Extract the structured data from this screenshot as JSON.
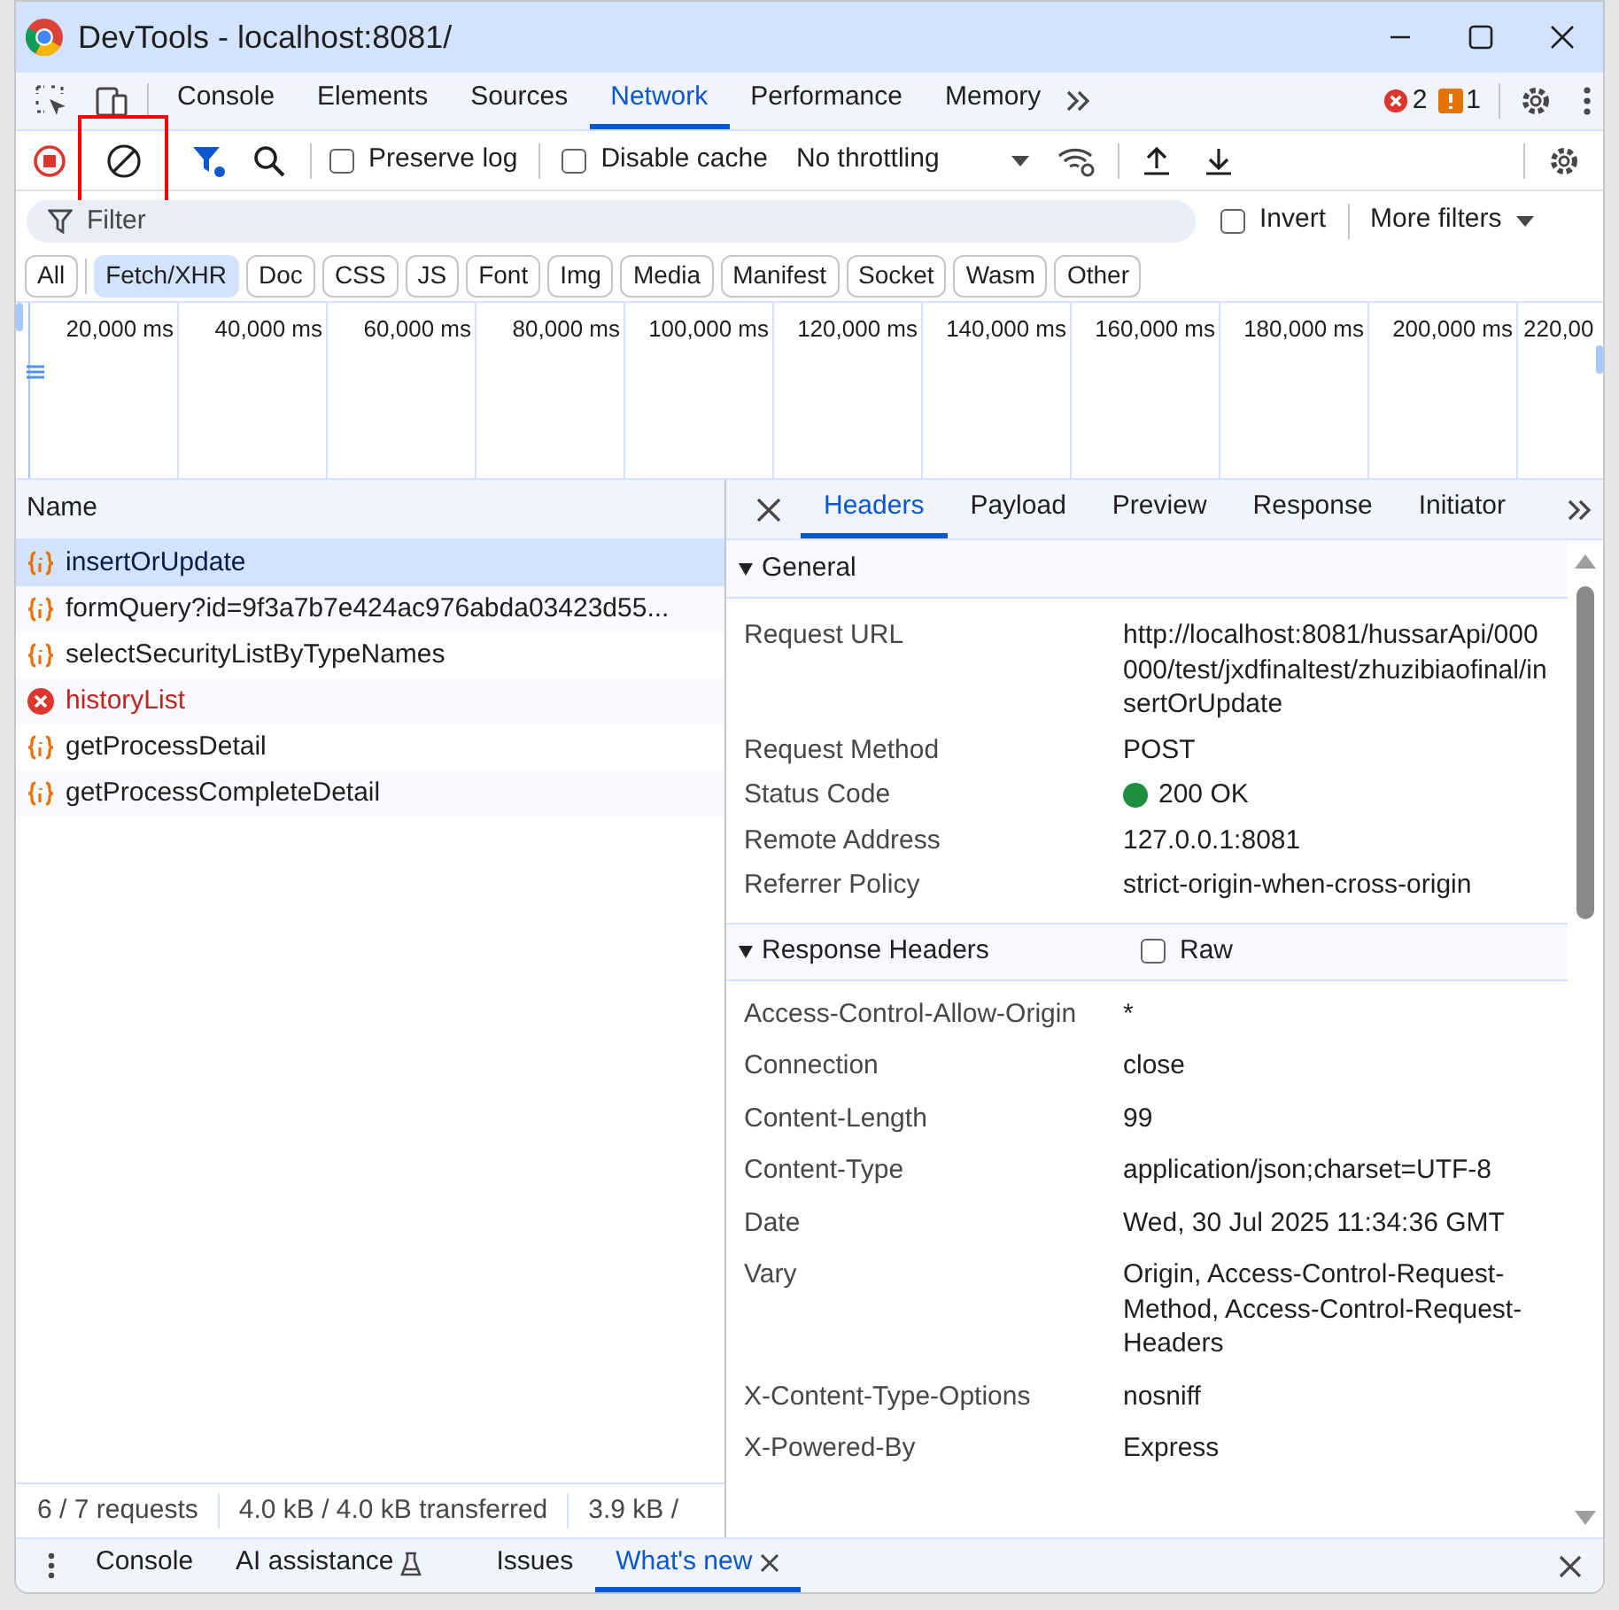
{
  "window": {
    "title": "DevTools - localhost:8081/"
  },
  "main_tabs": [
    {
      "label": "Console",
      "selected": false
    },
    {
      "label": "Elements",
      "selected": false
    },
    {
      "label": "Sources",
      "selected": false
    },
    {
      "label": "Network",
      "selected": true
    },
    {
      "label": "Performance",
      "selected": false
    },
    {
      "label": "Memory",
      "selected": false
    }
  ],
  "issue_counts": {
    "errors": "2",
    "warnings": "1"
  },
  "toolbar": {
    "preserve_log": {
      "label": "Preserve log",
      "checked": false
    },
    "disable_cache": {
      "label": "Disable cache",
      "checked": false
    },
    "throttling": "No throttling"
  },
  "filter": {
    "placeholder": "Filter",
    "invert": {
      "label": "Invert",
      "checked": false
    },
    "more_filters": "More filters"
  },
  "type_filters": [
    {
      "label": "All",
      "selected": false
    },
    {
      "label": "Fetch/XHR",
      "selected": true
    },
    {
      "label": "Doc",
      "selected": false
    },
    {
      "label": "CSS",
      "selected": false
    },
    {
      "label": "JS",
      "selected": false
    },
    {
      "label": "Font",
      "selected": false
    },
    {
      "label": "Img",
      "selected": false
    },
    {
      "label": "Media",
      "selected": false
    },
    {
      "label": "Manifest",
      "selected": false
    },
    {
      "label": "Socket",
      "selected": false
    },
    {
      "label": "Wasm",
      "selected": false
    },
    {
      "label": "Other",
      "selected": false
    }
  ],
  "timeline": {
    "ticks": [
      "20,000 ms",
      "40,000 ms",
      "60,000 ms",
      "80,000 ms",
      "100,000 ms",
      "120,000 ms",
      "140,000 ms",
      "160,000 ms",
      "180,000 ms",
      "200,000 ms",
      "220,00"
    ]
  },
  "requests": {
    "column": "Name",
    "rows": [
      {
        "name": "insertOrUpdate",
        "selected": true,
        "kind": "xhr"
      },
      {
        "name": "formQuery?id=9f3a7b7e424ac976abda03423d55...",
        "selected": false,
        "kind": "xhr"
      },
      {
        "name": "selectSecurityListByTypeNames",
        "selected": false,
        "kind": "xhr"
      },
      {
        "name": "historyList",
        "selected": false,
        "kind": "error"
      },
      {
        "name": "getProcessDetail",
        "selected": false,
        "kind": "xhr"
      },
      {
        "name": "getProcessCompleteDetail",
        "selected": false,
        "kind": "xhr"
      }
    ]
  },
  "summary": [
    "6 / 7 requests",
    "4.0 kB / 4.0 kB transferred",
    "3.9 kB /"
  ],
  "details": {
    "tabs": [
      {
        "label": "Headers",
        "selected": true
      },
      {
        "label": "Payload",
        "selected": false
      },
      {
        "label": "Preview",
        "selected": false
      },
      {
        "label": "Response",
        "selected": false
      },
      {
        "label": "Initiator",
        "selected": false
      }
    ],
    "sections": [
      {
        "title": "General",
        "expanded": true,
        "rows": [
          {
            "label": "Request URL",
            "value": "http://localhost:8081/hussarApi/000000/test/jxdfinaltest/zhuzibiaofinal/insertOrUpdate"
          },
          {
            "label": "Request Method",
            "value": "POST"
          },
          {
            "label": "Status Code",
            "value": "200 OK",
            "kind": "status"
          },
          {
            "label": "Remote Address",
            "value": "127.0.0.1:8081"
          },
          {
            "label": "Referrer Policy",
            "value": "strict-origin-when-cross-origin"
          }
        ]
      },
      {
        "title": "Response Headers",
        "expanded": true,
        "raw": {
          "label": "Raw",
          "checked": false
        },
        "rows": [
          {
            "label": "Access-Control-Allow-Origin",
            "value": "*"
          },
          {
            "label": "Connection",
            "value": "close"
          },
          {
            "label": "Content-Length",
            "value": "99"
          },
          {
            "label": "Content-Type",
            "value": "application/json;charset=UTF-8"
          },
          {
            "label": "Date",
            "value": "Wed, 30 Jul 2025 11:34:36 GMT"
          },
          {
            "label": "Vary",
            "value": "Origin, Access-Control-Request-Method, Access-Control-Request-Headers"
          },
          {
            "label": "X-Content-Type-Options",
            "value": "nosniff"
          },
          {
            "label": "X-Powered-By",
            "value": "Express"
          }
        ]
      }
    ]
  },
  "drawer": {
    "tabs": [
      {
        "label": "Console",
        "selected": false
      },
      {
        "label": "AI assistance",
        "selected": false,
        "kind": "experimental"
      },
      {
        "label": "Issues",
        "selected": false
      },
      {
        "label": "What's new",
        "selected": true,
        "closable": true
      }
    ]
  }
}
